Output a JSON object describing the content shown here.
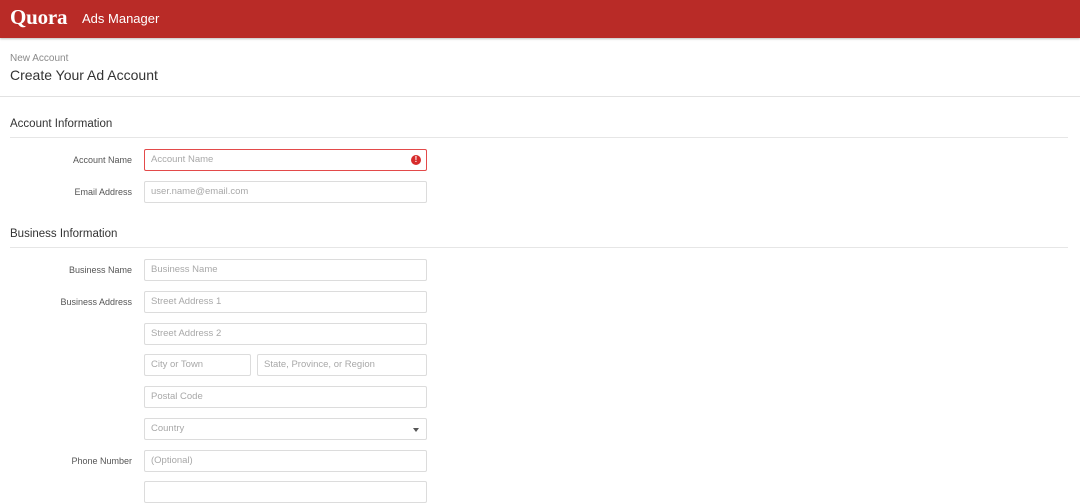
{
  "topbar": {
    "logo": "Quora",
    "product": "Ads Manager",
    "color": "#b92b27"
  },
  "header": {
    "breadcrumb": "New Account",
    "title": "Create Your Ad Account"
  },
  "account_section": {
    "title": "Account Information",
    "account_name": {
      "label": "Account Name",
      "placeholder": "Account Name",
      "error_icon": "exclamation-icon"
    },
    "email": {
      "label": "Email Address",
      "placeholder": "user.name@email.com"
    }
  },
  "business_section": {
    "title": "Business Information",
    "business_name": {
      "label": "Business Name",
      "placeholder": "Business Name"
    },
    "business_address": {
      "label": "Business Address",
      "street1": "Street Address 1",
      "street2": "Street Address 2",
      "city": "City or Town",
      "state": "State, Province, or Region",
      "postal": "Postal Code",
      "country": "Country"
    },
    "phone": {
      "label": "Phone Number",
      "placeholder": "(Optional)"
    }
  }
}
